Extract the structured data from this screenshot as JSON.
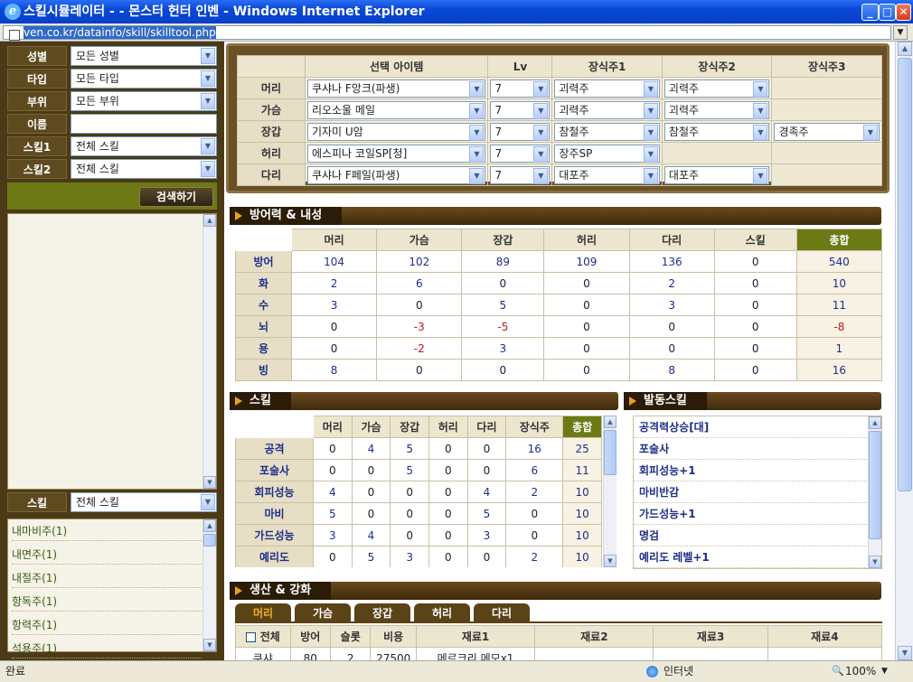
{
  "window": {
    "title": "스킬시뮬레이터 - - 몬스터 헌터 인벤 - Windows Internet Explorer",
    "url": "ven.co.kr/datainfo/skill/skilltool.php",
    "status": "완료",
    "zone": "인터넷",
    "zoom": "100%"
  },
  "filters": [
    {
      "label": "성별",
      "value": "모든 성별"
    },
    {
      "label": "타입",
      "value": "모든 타입"
    },
    {
      "label": "부위",
      "value": "모든 부위"
    },
    {
      "label": "이름",
      "value": ""
    },
    {
      "label": "스킬1",
      "value": "전체 스킬"
    },
    {
      "label": "스킬2",
      "value": "전체 스킬"
    }
  ],
  "search_label": "검색하기",
  "skill_filter": {
    "label": "스킬",
    "value": "전체 스킬"
  },
  "skill_list": [
    "내마비주(1)",
    "내면주(1)",
    "내절주(1)",
    "항독주(1)",
    "항력주(1)",
    "석용주(1)"
  ],
  "equip": {
    "headers": [
      "선택 아이템",
      "Lv",
      "장식주1",
      "장식주2",
      "장식주3"
    ],
    "rows": [
      {
        "part": "머리",
        "item": "쿠샤나 F앙크(파생)",
        "lv": "7",
        "d1": "괴력주",
        "d2": "괴력주",
        "d3": ""
      },
      {
        "part": "가슴",
        "item": "리오소울 메일",
        "lv": "7",
        "d1": "괴력주",
        "d2": "괴력주",
        "d3": ""
      },
      {
        "part": "장갑",
        "item": "기자미 U암",
        "lv": "7",
        "d1": "참철주",
        "d2": "참철주",
        "d3": "경족주"
      },
      {
        "part": "허리",
        "item": "에스피나 코일SP[청]",
        "lv": "7",
        "d1": "장주SP",
        "d2": "",
        "d3": ""
      },
      {
        "part": "다리",
        "item": "쿠샤나 F페일(파생)",
        "lv": "7",
        "d1": "대포주",
        "d2": "대포주",
        "d3": ""
      }
    ]
  },
  "defense": {
    "title": "방어력 & 내성",
    "headers": [
      "머리",
      "가슴",
      "장갑",
      "허리",
      "다리",
      "스킬",
      "총합"
    ],
    "rows": [
      {
        "label": "방어",
        "values": [
          "104",
          "102",
          "89",
          "109",
          "136",
          "0",
          "540"
        ]
      },
      {
        "label": "화",
        "values": [
          "2",
          "6",
          "0",
          "0",
          "2",
          "0",
          "10"
        ]
      },
      {
        "label": "수",
        "values": [
          "3",
          "0",
          "5",
          "0",
          "3",
          "0",
          "11"
        ]
      },
      {
        "label": "뇌",
        "values": [
          "0",
          "-3",
          "-5",
          "0",
          "0",
          "0",
          "-8"
        ]
      },
      {
        "label": "용",
        "values": [
          "0",
          "-2",
          "3",
          "0",
          "0",
          "0",
          "1"
        ]
      },
      {
        "label": "빙",
        "values": [
          "8",
          "0",
          "0",
          "0",
          "8",
          "0",
          "16"
        ]
      }
    ]
  },
  "skills": {
    "title": "스킬",
    "headers": [
      "머리",
      "가슴",
      "장갑",
      "허리",
      "다리",
      "장식주",
      "총합"
    ],
    "rows": [
      {
        "label": "공격",
        "values": [
          "0",
          "4",
          "5",
          "0",
          "0",
          "16",
          "25"
        ]
      },
      {
        "label": "포술사",
        "values": [
          "0",
          "0",
          "5",
          "0",
          "0",
          "6",
          "11"
        ]
      },
      {
        "label": "회피성능",
        "values": [
          "4",
          "0",
          "0",
          "0",
          "4",
          "2",
          "10"
        ]
      },
      {
        "label": "마비",
        "values": [
          "5",
          "0",
          "0",
          "0",
          "5",
          "0",
          "10"
        ]
      },
      {
        "label": "가드성능",
        "values": [
          "3",
          "4",
          "0",
          "0",
          "3",
          "0",
          "10"
        ]
      },
      {
        "label": "예리도",
        "values": [
          "0",
          "5",
          "3",
          "0",
          "0",
          "2",
          "10"
        ]
      }
    ]
  },
  "active": {
    "title": "발동스킬",
    "items": [
      "공격력상승[대]",
      "포술사",
      "회피성능+1",
      "마비반감",
      "가드성능+1",
      "명검",
      "예리도 레벨+1"
    ]
  },
  "production": {
    "title": "생산 & 강화",
    "tabs": [
      "머리",
      "가슴",
      "장갑",
      "허리",
      "다리"
    ],
    "headers": [
      "전체",
      "방어",
      "슬롯",
      "비용",
      "재료1",
      "재료2",
      "재료3",
      "재료4"
    ],
    "partial_row": [
      "쿠샤",
      "80",
      "2",
      "27500",
      "메르크리 메모x1"
    ]
  }
}
